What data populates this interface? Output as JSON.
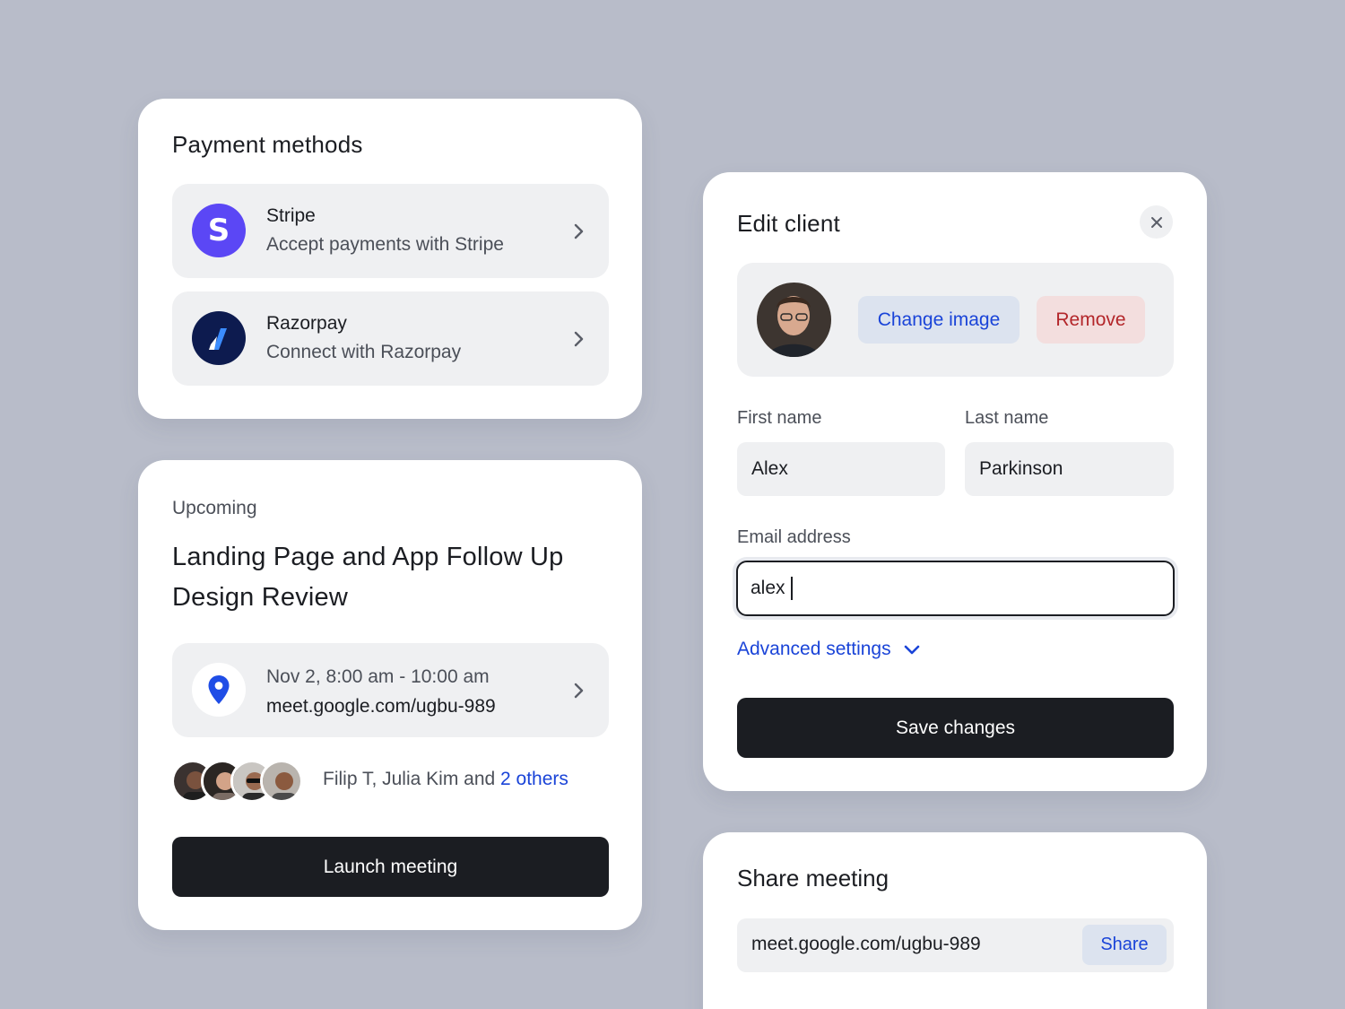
{
  "payment": {
    "title": "Payment methods",
    "methods": [
      {
        "name": "Stripe",
        "description": "Accept payments with Stripe",
        "logo_letter": "S",
        "icon": "stripe-logo-icon",
        "color": "#5b47f5"
      },
      {
        "name": "Razorpay",
        "description": "Connect with Razorpay",
        "icon": "razorpay-logo-icon",
        "color": "#0d1b4f"
      }
    ]
  },
  "meeting": {
    "label": "Upcoming",
    "title": "Landing Page and App Follow Up Design Review",
    "time": "Nov 2, 8:00 am - 10:00 am",
    "link": "meet.google.com/ugbu-989",
    "attendees_prefix": "Filip T, Julia Kim and ",
    "attendees_more": "2 others",
    "launch_label": "Launch meeting"
  },
  "edit_client": {
    "title": "Edit client",
    "change_image_label": "Change image",
    "remove_label": "Remove",
    "first_name_label": "First name",
    "first_name_value": "Alex",
    "last_name_label": "Last name",
    "last_name_value": "Parkinson",
    "email_label": "Email address",
    "email_value": "alex",
    "advanced_label": "Advanced settings",
    "save_label": "Save changes"
  },
  "share": {
    "title": "Share meeting",
    "link": "meet.google.com/ugbu-989",
    "share_label": "Share"
  },
  "colors": {
    "background": "#b8bcc9",
    "accent_blue": "#1a44d8",
    "dark_button": "#1b1d22",
    "danger": "#b3262a"
  }
}
